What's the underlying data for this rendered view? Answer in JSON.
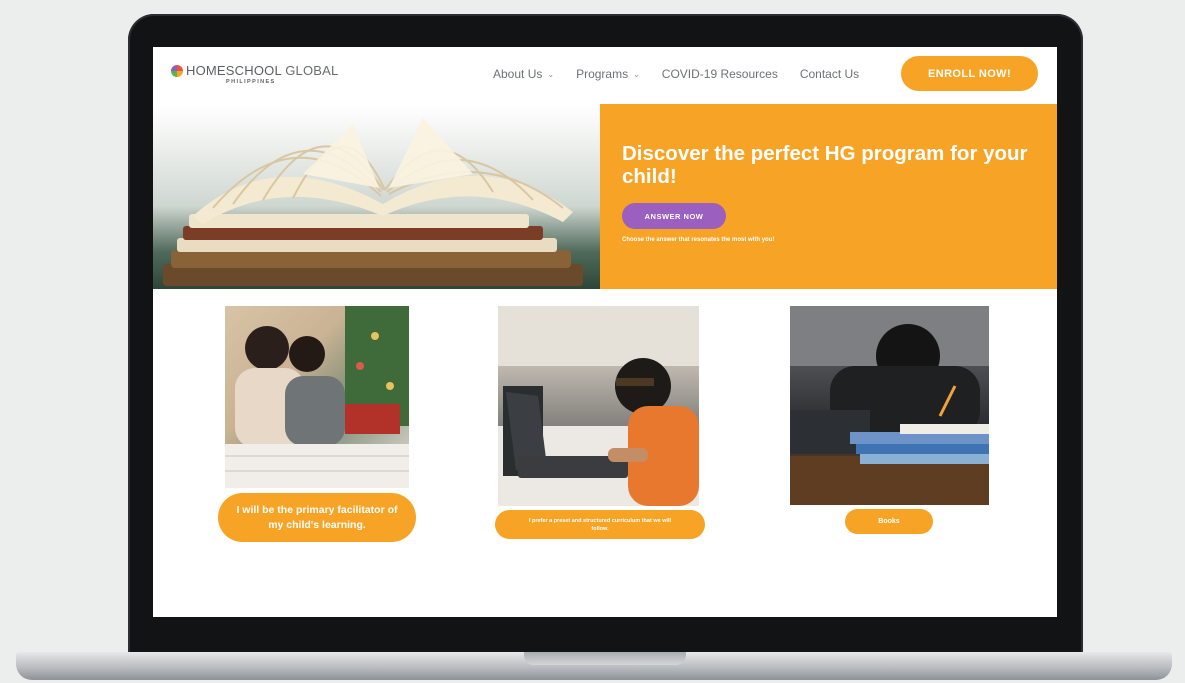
{
  "header": {
    "logo_main": "HOMESCHOOL",
    "logo_main_2": " GLOBAL",
    "logo_sub": "PHILIPPINES",
    "nav": [
      {
        "label": "About Us",
        "has_dropdown": true
      },
      {
        "label": "Programs",
        "has_dropdown": true
      },
      {
        "label": "COVID-19 Resources",
        "has_dropdown": false
      },
      {
        "label": "Contact Us",
        "has_dropdown": false
      }
    ],
    "enroll_label": "ENROLL NOW!"
  },
  "hero": {
    "title": "Discover the perfect HG program for your child!",
    "answer_label": "ANSWER NOW",
    "caption": "Choose the answer that resonates the most with you!"
  },
  "cards": [
    {
      "label": "I will be the primary facilitator of my child's learning."
    },
    {
      "label": "I prefer a preset and structured curriculum that we will follow."
    },
    {
      "label": "Books"
    }
  ],
  "colors": {
    "accent": "#f7a325",
    "purple": "#9b5fc0",
    "nav_text": "#6f7275"
  },
  "icons": {
    "nav_caret": "chevron-down-icon",
    "logo_mark": "logo-icon"
  }
}
